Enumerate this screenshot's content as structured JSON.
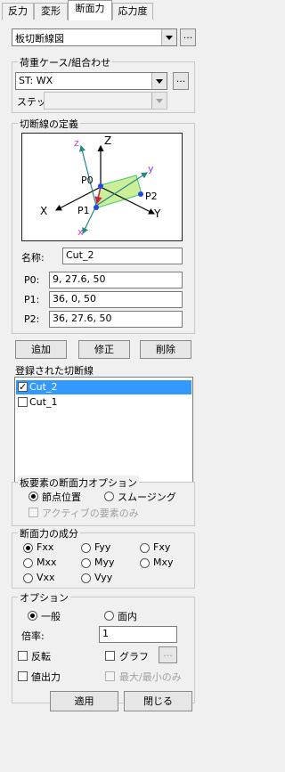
{
  "tabs": [
    {
      "label": "反力"
    },
    {
      "label": "変形"
    },
    {
      "label": "断面力"
    },
    {
      "label": "応力度"
    }
  ],
  "top_combo": {
    "value": "板切断線図",
    "extra_button": "..."
  },
  "load_case": {
    "title": "荷重ケース/組合わせ",
    "combo_value": "ST: WX",
    "extra_button": "...",
    "step_label": "ステップ"
  },
  "cut_def": {
    "title": "切断線の定義",
    "diagram_labels": {
      "z_small": "z",
      "z_big": "Z",
      "y_small": "y",
      "x_big": "X",
      "x_small": "x",
      "y_big": "Y",
      "p0": "P0",
      "p1": "P1",
      "p2": "P2"
    },
    "name_label": "名称:",
    "name_value": "Cut_2",
    "p0_label": "P0:",
    "p0_value": "9, 27.6, 50",
    "p1_label": "P1:",
    "p1_value": "36, 0, 50",
    "p2_label": "P2:",
    "p2_value": "36, 27.6, 50"
  },
  "buttons": {
    "add": "追加",
    "modify": "修正",
    "delete": "削除",
    "apply": "適用",
    "close": "閉じる",
    "graph_extra": "..."
  },
  "registered": {
    "title": "登録された切断線",
    "items": [
      {
        "label": "Cut_2",
        "checked": true,
        "selected": true
      },
      {
        "label": "Cut_1",
        "checked": false,
        "selected": false
      }
    ]
  },
  "section_option": {
    "title": "板要素の断面力オプション",
    "node_label": "節点位置",
    "smooth_label": "スムージング",
    "active_only_label": "アクティブの要素のみ"
  },
  "components": {
    "title": "断面力の成分",
    "items": [
      "Fxx",
      "Fyy",
      "Fxy",
      "Mxx",
      "Myy",
      "Mxy",
      "Vxx",
      "Vyy"
    ],
    "selected": "Fxx"
  },
  "options": {
    "title": "オプション",
    "general_label": "一般",
    "inplane_label": "面内",
    "scale_label": "倍率:",
    "scale_value": "1",
    "reverse_label": "反転",
    "graph_label": "グラフ",
    "value_output_label": "値出力",
    "maxmin_label": "最大/最小のみ"
  },
  "colors": {
    "selection": "#3399ff",
    "plane_fill": "#ccee99",
    "plane_edge": "#33cc66",
    "axis_small": "#cc44cc",
    "axis_y_small": "#9933ff",
    "axis_teal": "#228888",
    "point": "#2244ee",
    "diagram_bg": "#ffffff"
  }
}
